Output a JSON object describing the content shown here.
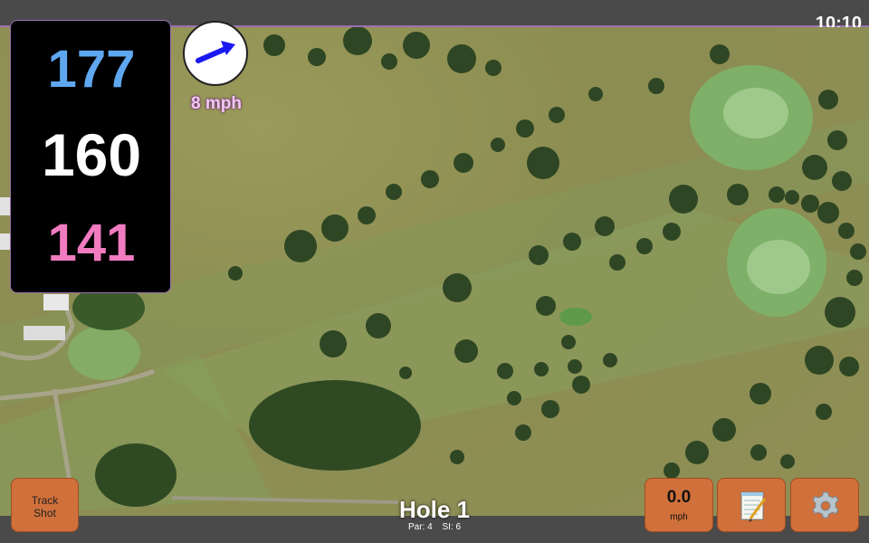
{
  "status_bar": {
    "time": "10:10"
  },
  "distances": {
    "back": "177",
    "middle": "160",
    "front": "141"
  },
  "wind": {
    "speed_label": "8 mph",
    "arrow_icon": "wind-arrow-icon"
  },
  "buttons": {
    "track_shot": {
      "line1": "Track",
      "line2": "Shot"
    },
    "speed": {
      "value": "0.0",
      "unit": "mph"
    },
    "notes_icon": "notepad-icon",
    "settings_icon": "gear-icon"
  },
  "hole": {
    "title": "Hole 1",
    "par_label": "Par: 4",
    "si_label": "SI: 6"
  },
  "colors": {
    "back": "#5fa8f0",
    "middle": "#ffffff",
    "front": "#f07bc0",
    "button": "#d0703a",
    "accent": "#9b6fb0"
  }
}
